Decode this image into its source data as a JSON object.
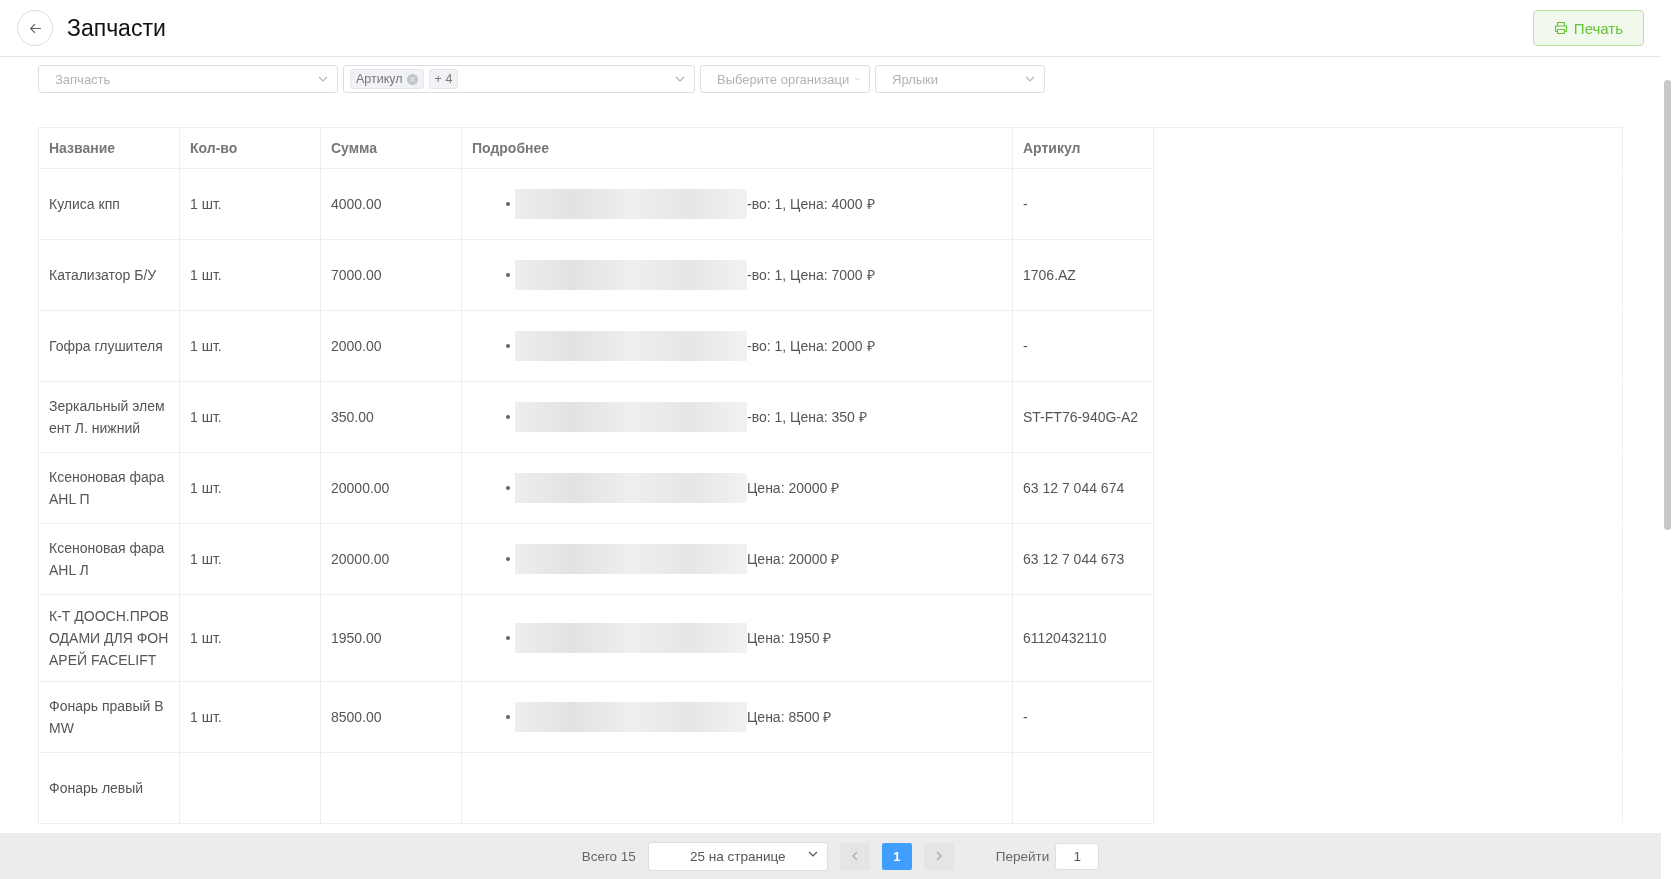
{
  "header": {
    "title": "Запчасти",
    "print_button": "Печать"
  },
  "filters": [
    {
      "kind": "select",
      "placeholder": "Запчасть"
    },
    {
      "kind": "tags",
      "tags": [
        "Артикул"
      ],
      "more": "+ 4"
    },
    {
      "kind": "select",
      "placeholder": "Выберите организаци"
    },
    {
      "kind": "select",
      "placeholder": "Ярлыки"
    }
  ],
  "table": {
    "columns": [
      "Название",
      "Кол-во",
      "Сумма",
      "Подробнее",
      "Артикул"
    ],
    "rows": [
      {
        "name": "Кулиса кпп",
        "qty": "1 шт.",
        "sum": "4000.00",
        "details": "-во: 1, Цена: 4000 ₽",
        "article": "-"
      },
      {
        "name": "Катализатор Б/У",
        "qty": "1 шт.",
        "sum": "7000.00",
        "details": "-во: 1, Цена: 7000 ₽",
        "article": "1706.AZ"
      },
      {
        "name": "Гофра глушителя",
        "qty": "1 шт.",
        "sum": "2000.00",
        "details": "-во: 1, Цена: 2000 ₽",
        "article": "-"
      },
      {
        "name": "Зеркальный элемент Л. нижний",
        "qty": "1 шт.",
        "sum": "350.00",
        "details": "-во: 1, Цена: 350 ₽",
        "article": "ST-FT76-940G-A2"
      },
      {
        "name": "Ксеноновая фара AHL П",
        "qty": "1 шт.",
        "sum": "20000.00",
        "details": "Цена: 20000 ₽",
        "article": "63 12 7 044 674"
      },
      {
        "name": "Ксеноновая фара AHL Л",
        "qty": "1 шт.",
        "sum": "20000.00",
        "details": "Цена: 20000 ₽",
        "article": "63 12 7 044 673"
      },
      {
        "name": "К-Т ДООСН.ПРОВОДАМИ ДЛЯ ФОНАРЕЙ FACELIFT",
        "qty": "1 шт.",
        "sum": "1950.00",
        "details": "Цена: 1950 ₽",
        "article": "61120432110"
      },
      {
        "name": "Фонарь правый BMW",
        "qty": "1 шт.",
        "sum": "8500.00",
        "details": "Цена: 8500 ₽",
        "article": "-"
      },
      {
        "name": "Фонарь левый",
        "qty": "",
        "sum": "",
        "details": "",
        "article": ""
      }
    ]
  },
  "pagination": {
    "total": "Всего 15",
    "page_size": "25 на странице",
    "pages": [
      {
        "label": "1",
        "selected": true
      }
    ],
    "goto_label": "Перейти",
    "goto_value": "1"
  }
}
